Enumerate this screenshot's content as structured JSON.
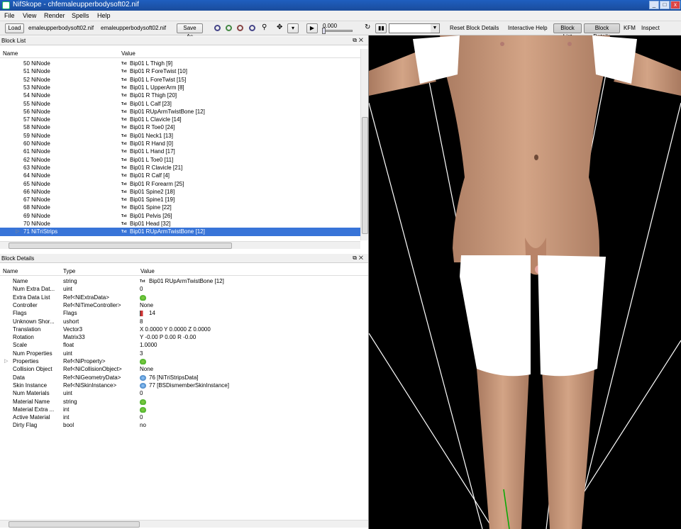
{
  "window": {
    "title": "NifSkope - chfemaleupperbodysoft02.nif"
  },
  "menu": [
    "File",
    "View",
    "Render",
    "Spells",
    "Help"
  ],
  "toolbar": {
    "load_label": "Load",
    "load_path": "emaleupperbodysoft02.nif",
    "save_path": "emaleupperbodysoft02.nif",
    "save_as_label": "Save As",
    "time_value": "0.000",
    "reset_label": "Reset Block Details",
    "help_label": "Interactive Help",
    "block_list_label": "Block List",
    "block_details_label": "Block Details",
    "kfm_label": "KFM",
    "inspect_label": "Inspect"
  },
  "block_list": {
    "title": "Block List",
    "col_name": "Name",
    "col_value": "Value",
    "rows": [
      {
        "name": "50 NiNode",
        "value": "Bip01 L Thigh [9]"
      },
      {
        "name": "51 NiNode",
        "value": "Bip01 R ForeTwist [10]"
      },
      {
        "name": "52 NiNode",
        "value": "Bip01 L ForeTwist [15]"
      },
      {
        "name": "53 NiNode",
        "value": "Bip01 L UpperArm [8]"
      },
      {
        "name": "54 NiNode",
        "value": "Bip01 R Thigh [20]"
      },
      {
        "name": "55 NiNode",
        "value": "Bip01 L Calf [23]"
      },
      {
        "name": "56 NiNode",
        "value": "Bip01 RUpArmTwistBone [12]"
      },
      {
        "name": "57 NiNode",
        "value": "Bip01 L Clavicle [14]"
      },
      {
        "name": "58 NiNode",
        "value": "Bip01 R Toe0 [24]"
      },
      {
        "name": "59 NiNode",
        "value": "Bip01 Neck1 [13]"
      },
      {
        "name": "60 NiNode",
        "value": "Bip01 R Hand [0]"
      },
      {
        "name": "61 NiNode",
        "value": "Bip01 L Hand [17]"
      },
      {
        "name": "62 NiNode",
        "value": "Bip01 L Toe0 [11]"
      },
      {
        "name": "63 NiNode",
        "value": "Bip01 R Clavicle [21]"
      },
      {
        "name": "64 NiNode",
        "value": "Bip01 R Calf [4]"
      },
      {
        "name": "65 NiNode",
        "value": "Bip01 R Forearm [25]"
      },
      {
        "name": "66 NiNode",
        "value": "Bip01 Spine2 [18]"
      },
      {
        "name": "67 NiNode",
        "value": "Bip01 Spine1 [19]"
      },
      {
        "name": "68 NiNode",
        "value": "Bip01 Spine [22]"
      },
      {
        "name": "69 NiNode",
        "value": "Bip01 Pelvis [26]"
      },
      {
        "name": "70 NiNode",
        "value": "Bip01 Head [32]"
      },
      {
        "name": "71 NiTriStrips",
        "value": "Bip01 RUpArmTwistBone [12]"
      }
    ]
  },
  "block_details": {
    "title": "Block Details",
    "col_name": "Name",
    "col_type": "Type",
    "col_value": "Value",
    "rows": [
      {
        "name": "Name",
        "type": "string",
        "value": "Bip01 RUpArmTwistBone [12]",
        "icon": "txt"
      },
      {
        "name": "Num Extra Dat...",
        "type": "uint",
        "value": "0",
        "icon": ""
      },
      {
        "name": "Extra Data List",
        "type": "Ref<NiExtraData>",
        "value": "",
        "icon": "green"
      },
      {
        "name": "Controller",
        "type": "Ref<NiTimeController>",
        "value": "None",
        "icon": ""
      },
      {
        "name": "Flags",
        "type": "Flags",
        "value": "14",
        "icon": "flag"
      },
      {
        "name": "Unknown Shor...",
        "type": "ushort",
        "value": "8",
        "icon": ""
      },
      {
        "name": "Translation",
        "type": "Vector3",
        "value": "X 0.0000 Y 0.0000 Z 0.0000",
        "icon": ""
      },
      {
        "name": "Rotation",
        "type": "Matrix33",
        "value": "Y -0.00 P 0.00 R -0.00",
        "icon": ""
      },
      {
        "name": "Scale",
        "type": "float",
        "value": "1.0000",
        "icon": ""
      },
      {
        "name": "Num Properties",
        "type": "uint",
        "value": "3",
        "icon": ""
      },
      {
        "name": "Properties",
        "type": "Ref<NiProperty>",
        "value": "",
        "icon": "green"
      },
      {
        "name": "Collision Object",
        "type": "Ref<NiCollisionObject>",
        "value": "None",
        "icon": ""
      },
      {
        "name": "Data",
        "type": "Ref<NiGeometryData>",
        "value": "76 [NiTriStripsData]",
        "icon": "blue"
      },
      {
        "name": "Skin Instance",
        "type": "Ref<NiSkinInstance>",
        "value": "77 [BSDismemberSkinInstance]",
        "icon": "blue"
      },
      {
        "name": "Num Materials",
        "type": "uint",
        "value": "0",
        "icon": ""
      },
      {
        "name": "Material Name",
        "type": "string",
        "value": "",
        "icon": "green"
      },
      {
        "name": "Material Extra ...",
        "type": "int",
        "value": "",
        "icon": "green"
      },
      {
        "name": "Active Material",
        "type": "int",
        "value": "0",
        "icon": ""
      },
      {
        "name": "Dirty Flag",
        "type": "bool",
        "value": "no",
        "icon": ""
      }
    ]
  },
  "colors": {
    "selection": "#3874d8",
    "titlebar": "#1f5fbf",
    "viewport_bg": "#000000"
  }
}
